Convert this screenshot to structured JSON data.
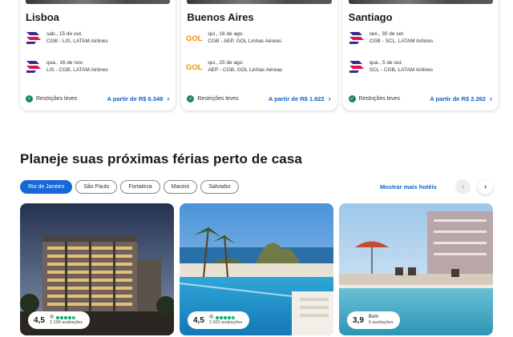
{
  "flights": [
    {
      "city": "Lisboa",
      "legs": [
        {
          "airline": "latam",
          "date": "sab., 15 de out.",
          "route": "CGB - LIS, LATAM Airlines"
        },
        {
          "airline": "latam",
          "date": "qua., 16 de nov.",
          "route": "LIS - CGB, LATAM Airlines"
        }
      ],
      "restrictions": "Restrições leves",
      "price": "A partir de R$ 6.348"
    },
    {
      "city": "Buenos Aires",
      "legs": [
        {
          "airline": "gol",
          "date": "qui., 18 de ago.",
          "route": "CGB - AEP, GOL Linhas Aéreas"
        },
        {
          "airline": "gol",
          "date": "qui., 25 de ago.",
          "route": "AEP - CGB, GOL Linhas Aéreas"
        }
      ],
      "restrictions": "Restrições leves",
      "price": "A partir de R$ 1.822"
    },
    {
      "city": "Santiago",
      "legs": [
        {
          "airline": "latam",
          "date": "sex., 30 de set.",
          "route": "CGB - SCL, LATAM Airlines"
        },
        {
          "airline": "latam",
          "date": "qua., 5 de out.",
          "route": "SCL - CGB, LATAM Airlines"
        }
      ],
      "restrictions": "Restrições leves",
      "price": "A partir de R$ 2.262"
    }
  ],
  "gol_logo_text": "GOL",
  "section": {
    "title": "Planeje suas próximas férias perto de casa",
    "chips": [
      "Rio de Janeiro",
      "São Paulo",
      "Fortaleza",
      "Maceió",
      "Salvador"
    ],
    "active_chip": 0,
    "show_more": "Mostrar mais hotéis",
    "prev_icon": "‹",
    "next_icon": "›"
  },
  "hotels": [
    {
      "score": "4,5",
      "reviews": "2.198 avaliações",
      "bubbles": 4.5,
      "label": ""
    },
    {
      "score": "4,5",
      "reviews": "2.420 avaliações",
      "bubbles": 4.5,
      "label": ""
    },
    {
      "score": "3,9",
      "reviews": "6 avaliações",
      "bubbles": null,
      "label": "Bom"
    }
  ],
  "colors": {
    "accent": "#1668d8",
    "link": "#0b63c8",
    "check_green": "#1a8a5a",
    "tripadvisor_green": "#00aa6c",
    "latam_purple": "#3c2a8a",
    "latam_red": "#e2124e",
    "gol_orange": "#f28a00"
  }
}
